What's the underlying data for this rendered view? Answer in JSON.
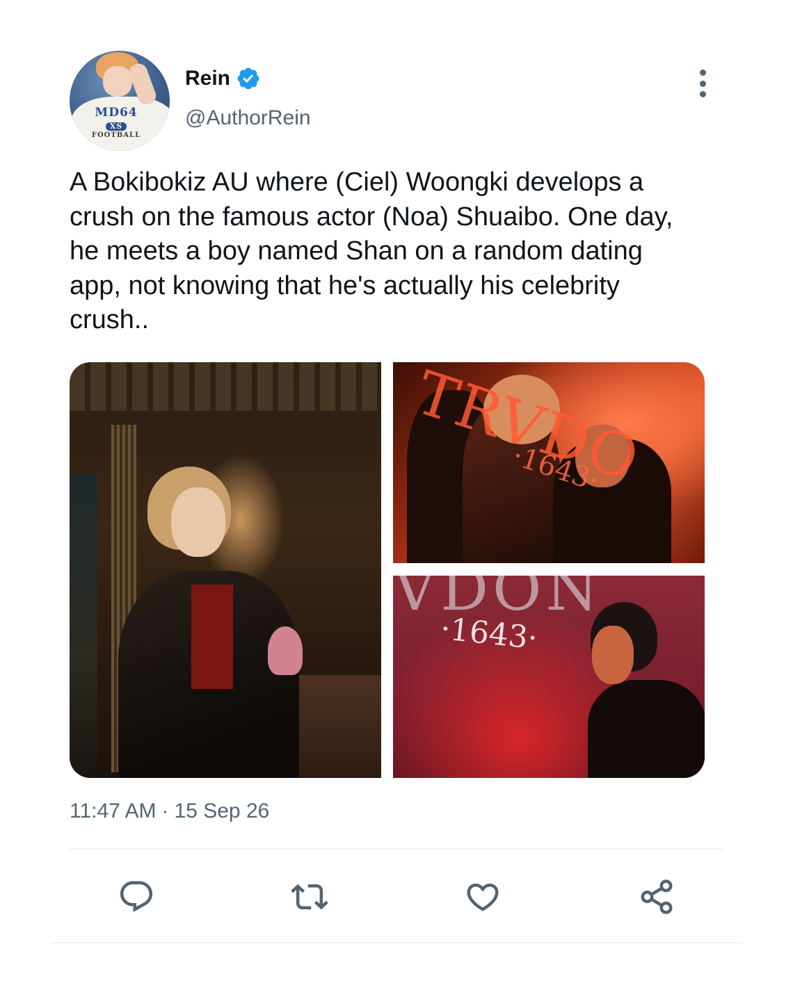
{
  "author": {
    "display_name": "Rein",
    "handle": "@AuthorRein",
    "verified": true,
    "avatar_print": {
      "line1": "MD64",
      "badge": "XS",
      "line2": "FOOTBALL"
    }
  },
  "tweet": {
    "text": "A Bokibokiz AU where (Ciel) Woongki develops a\ncrush on the famous actor (Noa) Shuaibo. One day,\nhe meets a boy named Shan on a random dating\napp, not knowing that he's actually his celebrity\ncrush..",
    "time": "11:47 AM",
    "separator": "·",
    "date": "15 Sep 26"
  },
  "media": {
    "top_right_watermark": "TRVDO",
    "top_right_number": "·1643·",
    "bottom_right_watermark": "VDON",
    "bottom_right_number": "·1643·"
  },
  "actions": [
    {
      "name": "reply",
      "icon": "reply-icon"
    },
    {
      "name": "retweet",
      "icon": "retweet-icon"
    },
    {
      "name": "like",
      "icon": "heart-icon"
    },
    {
      "name": "share",
      "icon": "share-icon"
    }
  ],
  "colors": {
    "verified": "#1d9bf0",
    "secondary_text": "#536471",
    "primary_text": "#0f1419"
  }
}
